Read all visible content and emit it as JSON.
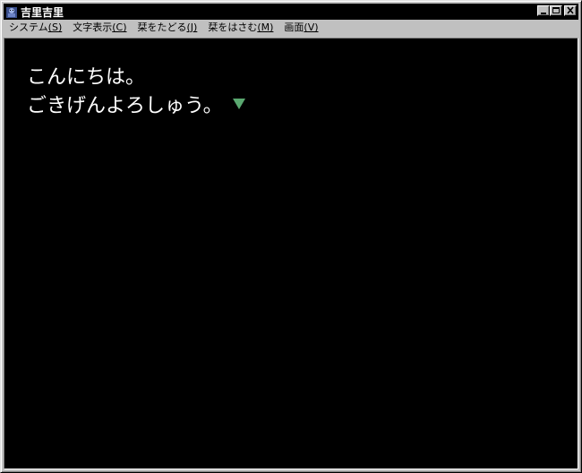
{
  "window": {
    "title": "吉里吉里",
    "icon": "kirikiri-app-icon",
    "controls": [
      "minimize-icon",
      "maximize-icon",
      "close-icon"
    ]
  },
  "menubar": {
    "items": [
      {
        "label": "システム",
        "accel": "(S)"
      },
      {
        "label": "文字表示",
        "accel": "(C)"
      },
      {
        "label": "栞をたどる",
        "accel": "(J)"
      },
      {
        "label": "栞をはさむ",
        "accel": "(M)"
      },
      {
        "label": "画面",
        "accel": "(V)"
      }
    ]
  },
  "message": {
    "lines": [
      "こんにちは。",
      "ごきげんよろしゅう。"
    ],
    "cursor_icon": "triangle-down-icon",
    "cursor_color": "#5aa870"
  },
  "colors": {
    "titlebar": "#000000",
    "chrome": "#c0c0c0",
    "client_bg": "#000000",
    "text": "#ffffff"
  }
}
